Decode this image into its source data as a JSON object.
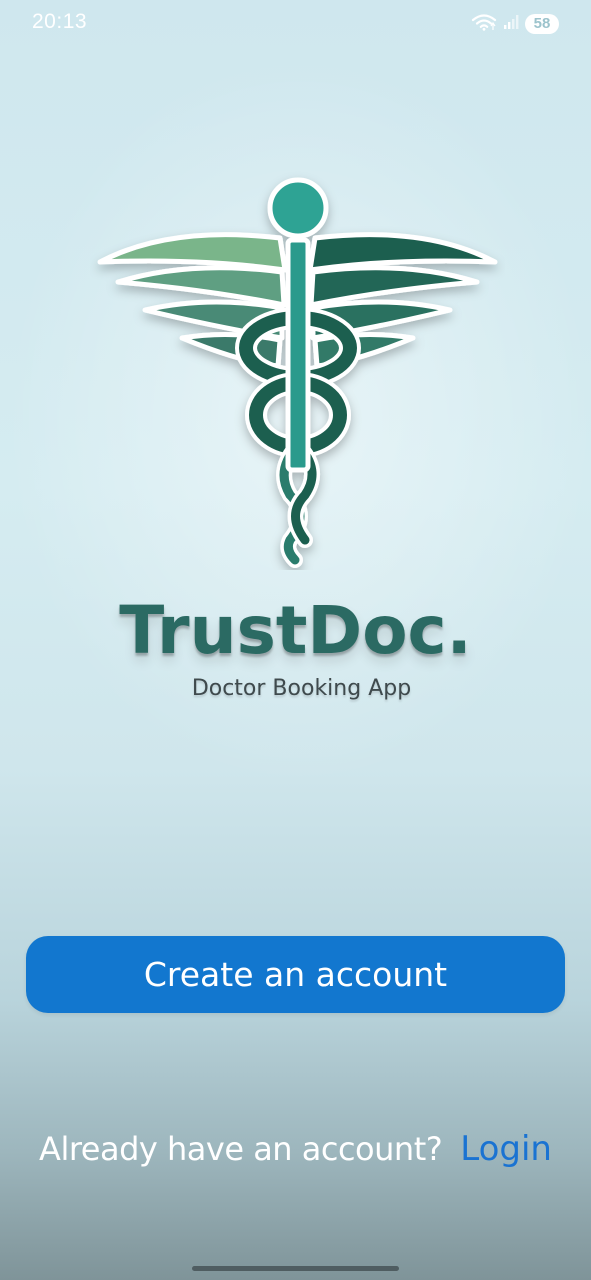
{
  "status_bar": {
    "time": "20:13",
    "wifi_icon": "wifi-icon",
    "signal_icon": "signal-icon",
    "battery_level": "58"
  },
  "branding": {
    "logo_icon": "caduceus-logo-icon",
    "title": "TrustDoc.",
    "subtitle": "Doctor Booking App"
  },
  "actions": {
    "create_account_label": "Create an account",
    "login_prompt": "Already have an account?",
    "login_label": "Login"
  },
  "colors": {
    "primary_button": "#1277cf",
    "login_link": "#1a73d2",
    "logo_teal": "#2a9a8c",
    "logo_dark_green": "#1f5e50",
    "logo_light_green": "#6fae7f"
  }
}
